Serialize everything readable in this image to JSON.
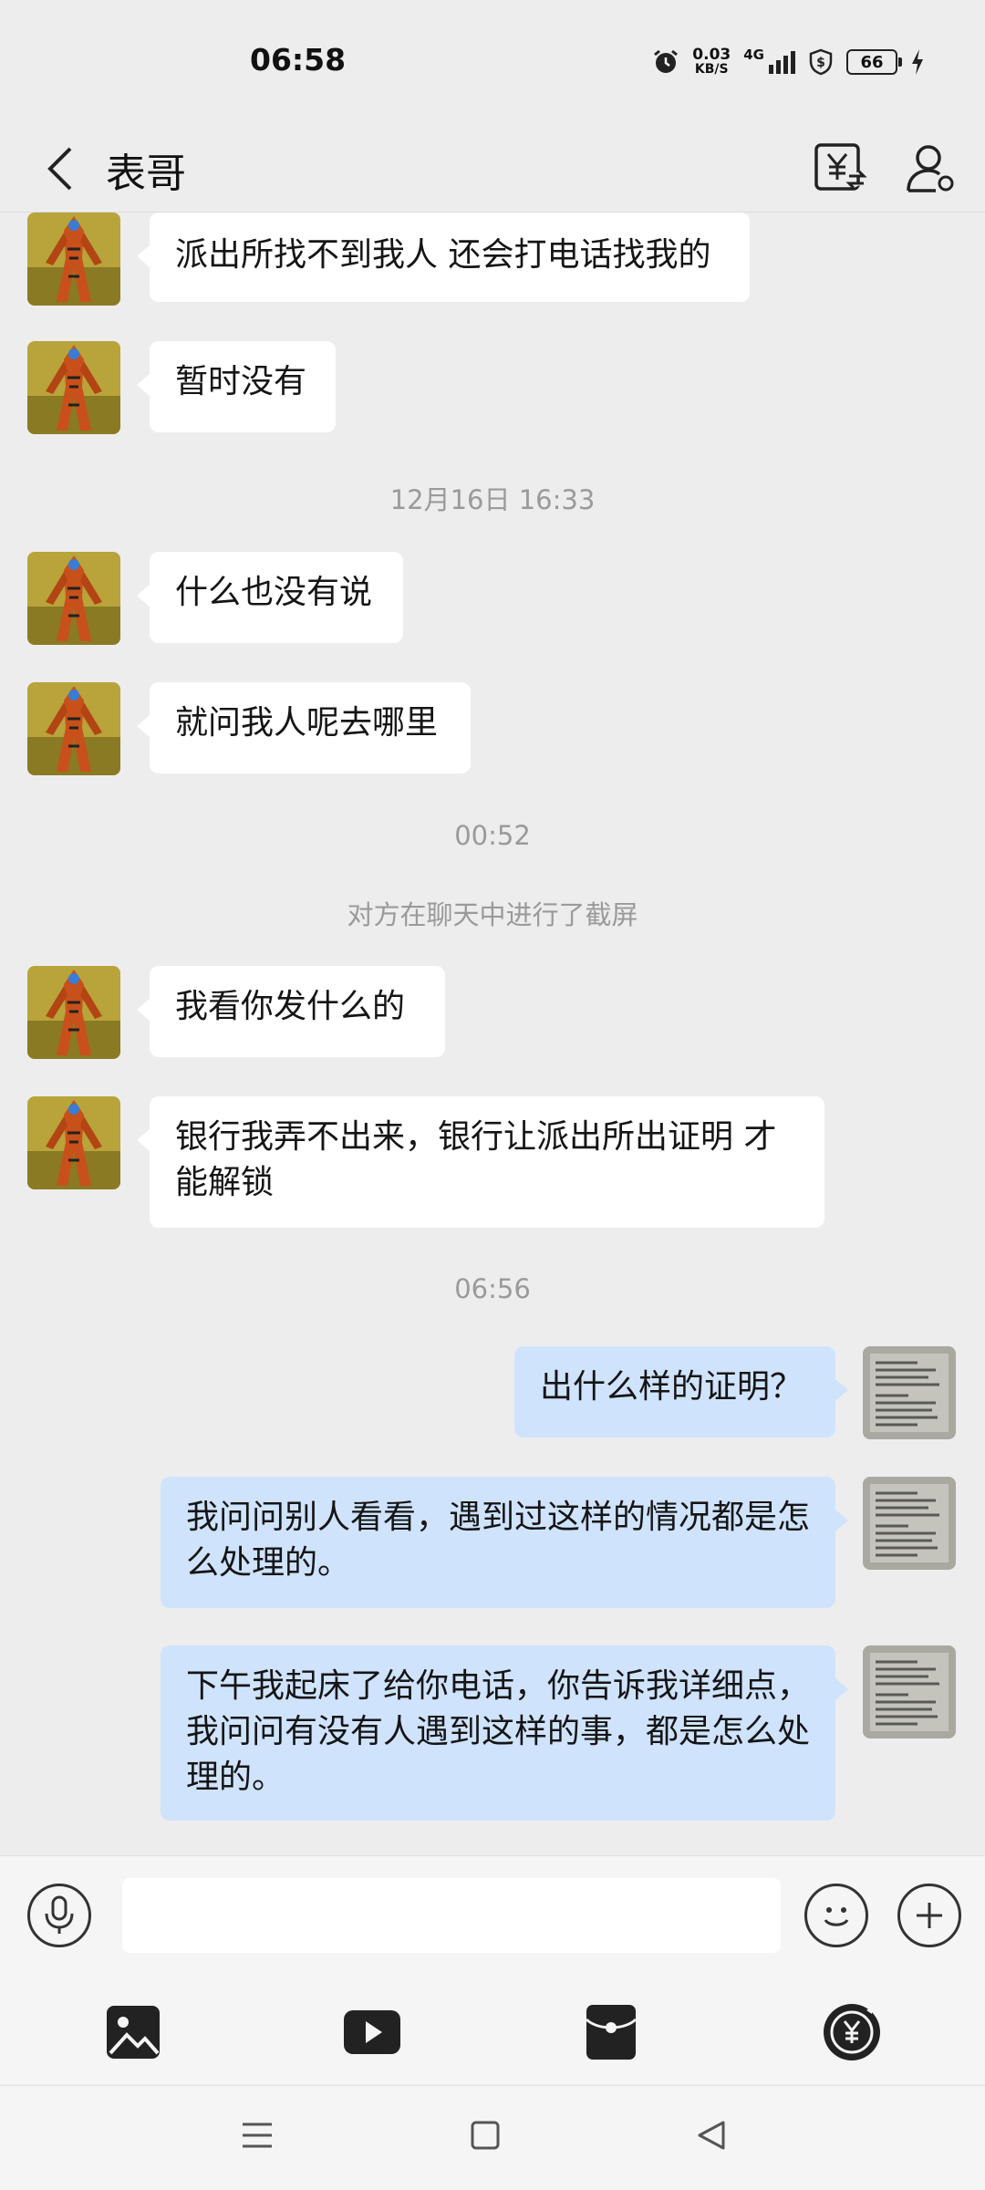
{
  "status_bar": {
    "time": "06:58",
    "net_speed_value": "0.03",
    "net_speed_unit": "KB/S",
    "network": "4G",
    "battery": "66"
  },
  "header": {
    "title": "表哥",
    "back_icon": "chevron-left-icon",
    "transfer_icon": "yen-transfer-icon",
    "profile_icon": "user-settings-icon"
  },
  "messages": [
    {
      "type": "text",
      "side": "left",
      "text": "派出所找不到我人 还会打电话找我的"
    },
    {
      "type": "text",
      "side": "left",
      "text": "暂时没有"
    },
    {
      "type": "time",
      "text": "12月16日 16:33"
    },
    {
      "type": "text",
      "side": "left",
      "text": "什么也没有说"
    },
    {
      "type": "text",
      "side": "left",
      "text": "就问我人呢去哪里"
    },
    {
      "type": "time",
      "text": "00:52"
    },
    {
      "type": "system",
      "text": "对方在聊天中进行了截屏"
    },
    {
      "type": "text",
      "side": "left",
      "text": "我看你发什么的"
    },
    {
      "type": "text",
      "side": "left",
      "text": "银行我弄不出来，银行让派出所出证明 才能解锁"
    },
    {
      "type": "time",
      "text": "06:56"
    },
    {
      "type": "text",
      "side": "right",
      "text": "出什么样的证明？"
    },
    {
      "type": "text",
      "side": "right",
      "text": "我问问别人看看，遇到过这样的情况都是怎么处理的。"
    },
    {
      "type": "text",
      "side": "right",
      "text": "下午我起床了给你电话，你告诉我详细点，我问问有没有人遇到这样的事，都是怎么处理的。"
    }
  ],
  "input": {
    "voice_icon": "microphone-icon",
    "placeholder": "",
    "emoji_icon": "smiley-icon",
    "more_icon": "plus-icon"
  },
  "toolbar": {
    "items": [
      "image-icon",
      "video-icon",
      "red-packet-icon",
      "transfer-icon"
    ]
  },
  "colors": {
    "background": "#ededed",
    "incoming_bubble": "#ffffff",
    "outgoing_bubble": "#cfe3fd",
    "timestamp": "#9a9a9a"
  }
}
